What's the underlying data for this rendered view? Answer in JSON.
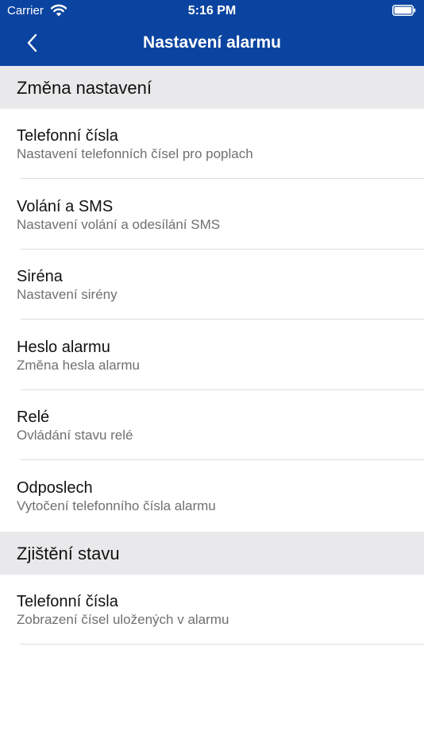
{
  "status_bar": {
    "carrier": "Carrier",
    "time": "5:16 PM",
    "wifi_icon": "wifi-icon",
    "battery_icon": "battery-icon"
  },
  "nav": {
    "title": "Nastavení alarmu",
    "back_icon": "chevron-left-icon"
  },
  "colors": {
    "nav_background": "#0b44a0",
    "section_background": "#e9e9eb",
    "subtitle_text": "#707070"
  },
  "sections": [
    {
      "header": "Změna nastavení",
      "items": [
        {
          "title": "Telefonní čísla",
          "subtitle": "Nastavení telefonních čísel pro poplach"
        },
        {
          "title": "Volání a SMS",
          "subtitle": "Nastavení volání a odesílání SMS"
        },
        {
          "title": "Siréna",
          "subtitle": "Nastavení sirény"
        },
        {
          "title": "Heslo alarmu",
          "subtitle": "Změna hesla alarmu"
        },
        {
          "title": "Relé",
          "subtitle": "Ovládání stavu relé"
        },
        {
          "title": "Odposlech",
          "subtitle": "Vytočení telefonního čísla alarmu"
        }
      ]
    },
    {
      "header": "Zjištění stavu",
      "items": [
        {
          "title": "Telefonní čísla",
          "subtitle": "Zobrazení čísel uložených v alarmu"
        }
      ]
    }
  ]
}
